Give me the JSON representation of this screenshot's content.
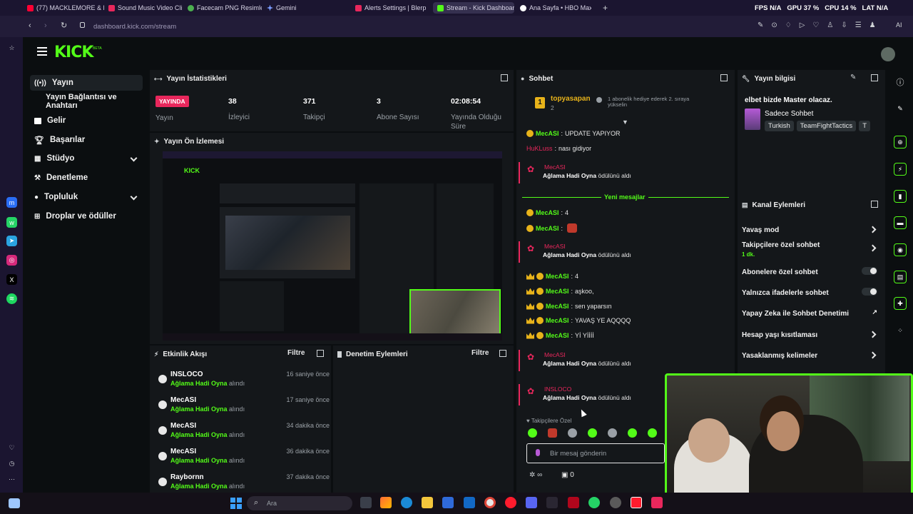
{
  "browser": {
    "tabs": [
      {
        "label": "(77) MACKLEMORE & RY...",
        "color": "#ff0033"
      },
      {
        "label": "Sound Music Video Clips...",
        "color": "#e8275c"
      },
      {
        "label": "Facecam PNG Resimleri | c...",
        "color": "#4caf50"
      },
      {
        "label": "Gemini",
        "color": "#7b9cff"
      },
      {
        "label": "Alerts Settings | Blerp",
        "color": "#e8275c"
      },
      {
        "label": "Stream - Kick Dashboard",
        "color": "#53fc18"
      },
      {
        "label": "Ana Sayfa • HBO Max",
        "color": "#ffffff"
      }
    ],
    "url": "dashboard.kick.com/stream",
    "overlay": {
      "fps_label": "FPS",
      "fps_value": "N/A",
      "gpu_label": "GPU",
      "gpu_value": "37 %",
      "cpu_label": "CPU",
      "cpu_value": "14 %",
      "lat_label": "LAT",
      "lat_value": "N/A"
    },
    "ai_label": "AI"
  },
  "kick": {
    "logo": "KICK",
    "beta": "BETA"
  },
  "nav": {
    "items": [
      {
        "label": "Yayın",
        "icon": "broadcast-icon"
      },
      {
        "label": "Yayın Bağlantısı ve Anahtarı",
        "icon": ""
      },
      {
        "label": "Gelir",
        "icon": "money-icon"
      },
      {
        "label": "Başarılar",
        "icon": "trophy-icon"
      },
      {
        "label": "Stüdyo",
        "icon": "studio-icon"
      },
      {
        "label": "Denetleme",
        "icon": "hammer-icon"
      },
      {
        "label": "Topluluk",
        "icon": "community-icon"
      },
      {
        "label": "Droplar ve ödüller",
        "icon": "gift-icon"
      }
    ]
  },
  "stats": {
    "title": "Yayın İstatistikleri",
    "live_badge": "YAYINDA",
    "live_label": "Yayın",
    "items": [
      {
        "value": "38",
        "label": "İzleyici"
      },
      {
        "value": "371",
        "label": "Takipçi"
      },
      {
        "value": "3",
        "label": "Abone Sayısı"
      },
      {
        "value": "02:08:54",
        "label": "Yayında Olduğu Süre"
      }
    ]
  },
  "preview": {
    "title": "Yayın Ön İzlemesi"
  },
  "activity": {
    "title": "Etkinlik Akışı",
    "filter": "Filtre",
    "events": [
      {
        "name": "INSLOCO",
        "reward": "Ağlama Hadi Oyna",
        "suffix": "alındı",
        "time": "16 saniye önce"
      },
      {
        "name": "MecASI",
        "reward": "Ağlama Hadi Oyna",
        "suffix": "alındı",
        "time": "17 saniye önce"
      },
      {
        "name": "MecASI",
        "reward": "Ağlama Hadi Oyna",
        "suffix": "alındı",
        "time": "34 dakika önce"
      },
      {
        "name": "MecASI",
        "reward": "Ağlama Hadi Oyna",
        "suffix": "alındı",
        "time": "36 dakika önce"
      },
      {
        "name": "Raybornn",
        "reward": "Ağlama Hadi Oyna",
        "suffix": "alındı",
        "time": "37 dakika önce"
      }
    ]
  },
  "moderation": {
    "title": "Denetim Eylemleri",
    "filter": "Filtre"
  },
  "chat": {
    "title": "Sohbet",
    "pinned_user": "topyasapan",
    "pinned_count": "2",
    "pinned_note": "1 abonelik hediye ederek 2. sıraya yükselin",
    "new_messages": "Yeni mesajlar",
    "followers_only": "Takipçilere Özel",
    "input_placeholder": "Bir mesaj gönderin",
    "bottom_count": "0",
    "lines": [
      {
        "type": "msg",
        "user": "MecASI",
        "text": "UPDATE YAPIYOR"
      },
      {
        "type": "msg2",
        "user": "HuKLuss",
        "text": "nası gidiyor"
      },
      {
        "type": "redeem",
        "user": "MecASI",
        "reward": "Ağlama Hadi Oyna",
        "suffix": "ödülünü aldı"
      },
      {
        "type": "msg",
        "user": "MecASI",
        "text": "4"
      },
      {
        "type": "msg",
        "user": "MecASI",
        "text": ""
      },
      {
        "type": "redeem",
        "user": "MecASI",
        "reward": "Ağlama Hadi Oyna",
        "suffix": "ödülünü aldı"
      },
      {
        "type": "msg",
        "user": "MecASI",
        "text": "4"
      },
      {
        "type": "msg",
        "user": "MecASI",
        "text": "aşkoo,"
      },
      {
        "type": "msg",
        "user": "MecASI",
        "text": "sen yaparsın"
      },
      {
        "type": "msg",
        "user": "MecASI",
        "text": "YAVAŞ YE AQQQQ"
      },
      {
        "type": "msg",
        "user": "MecASI",
        "text": "Yİ Yİİİİ"
      },
      {
        "type": "redeem",
        "user": "MecASI",
        "reward": "Ağlama Hadi Oyna",
        "suffix": "ödülünü aldı"
      },
      {
        "type": "redeem",
        "user": "INSLOCO",
        "reward": "Ağlama Hadi Oyna",
        "suffix": "ödülünü aldı"
      }
    ]
  },
  "streaminfo": {
    "title": "Yayın bilgisi",
    "stream_title": "elbet bizde Master olacaz.",
    "category": "Sadece Sohbet",
    "tags": [
      "Turkish",
      "TeamFightTactics",
      "T"
    ]
  },
  "channel_actions": {
    "title": "Kanal Eylemleri",
    "items": [
      {
        "label": "Yavaş mod",
        "sub": "",
        "control": "chevron"
      },
      {
        "label": "Takipçilere özel sohbet",
        "sub": "1 dk.",
        "control": "chevron"
      },
      {
        "label": "Abonelere özel sohbet",
        "sub": "",
        "control": "toggle"
      },
      {
        "label": "Yalnızca ifadelerle sohbet",
        "sub": "",
        "control": "toggle"
      },
      {
        "label": "Yapay Zeka ile Sohbet Denetimi",
        "sub": "",
        "control": "external"
      },
      {
        "label": "Hesap yaşı kısıtlaması",
        "sub": "",
        "control": "chevron"
      },
      {
        "label": "Yasaklanmış kelimeler",
        "sub": "",
        "control": "chevron"
      }
    ]
  },
  "taskbar": {
    "search_placeholder": "Ara"
  },
  "colors": {
    "accent": "#53fc18",
    "live_red": "#e8275c",
    "background": "#0b0e10",
    "panel": "#14171a"
  }
}
